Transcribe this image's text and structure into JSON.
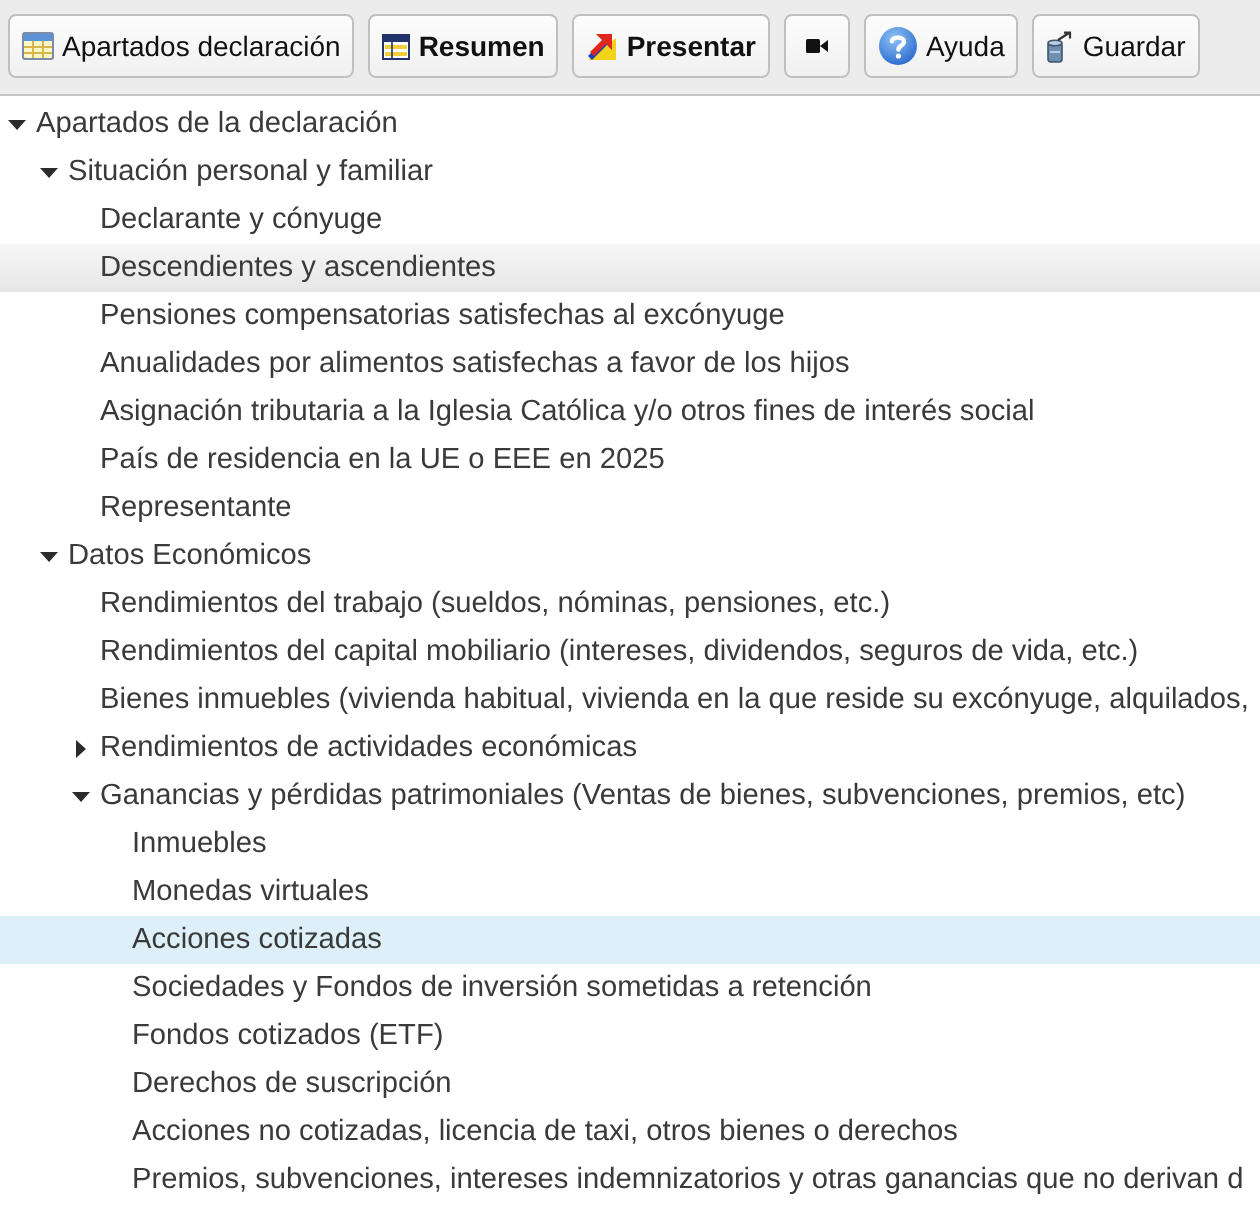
{
  "toolbar": {
    "buttons": [
      {
        "kind": "sections",
        "label": "Apartados declaración",
        "bold": false
      },
      {
        "kind": "summary",
        "label": "Resumen",
        "bold": true
      },
      {
        "kind": "submit",
        "label": "Presentar",
        "bold": true
      },
      {
        "kind": "video"
      },
      {
        "kind": "help",
        "label": "Ayuda",
        "bold": false
      },
      {
        "kind": "save",
        "label": "Guardar",
        "bold": false
      }
    ]
  },
  "tree": {
    "items": [
      {
        "label": "Apartados de la declaración",
        "expanded": true,
        "selected": false,
        "hovered": false,
        "children": [
          {
            "label": "Situación personal y familiar",
            "expanded": true,
            "selected": false,
            "hovered": false,
            "children": [
              {
                "label": "Declarante y cónyuge",
                "selected": false,
                "hovered": false
              },
              {
                "label": "Descendientes y ascendientes",
                "selected": false,
                "hovered": true
              },
              {
                "label": "Pensiones compensatorias satisfechas al excónyuge",
                "selected": false,
                "hovered": false
              },
              {
                "label": "Anualidades por alimentos satisfechas a favor de los hijos",
                "selected": false,
                "hovered": false
              },
              {
                "label": "Asignación tributaria a la Iglesia Católica y/o otros fines de interés social",
                "selected": false,
                "hovered": false
              },
              {
                "label": "País de residencia en la UE o EEE en 2025",
                "selected": false,
                "hovered": false
              },
              {
                "label": "Representante",
                "selected": false,
                "hovered": false
              }
            ]
          },
          {
            "label": "Datos Económicos",
            "expanded": true,
            "selected": false,
            "hovered": false,
            "children": [
              {
                "label": "Rendimientos del trabajo (sueldos, nóminas, pensiones, etc.)",
                "selected": false,
                "hovered": false
              },
              {
                "label": "Rendimientos del capital mobiliario (intereses, dividendos, seguros de vida, etc.)",
                "selected": false,
                "hovered": false
              },
              {
                "label": "Bienes inmuebles (vivienda habitual, vivienda en la que reside su excónyuge, alquilados,",
                "selected": false,
                "hovered": false
              },
              {
                "label": "Rendimientos de actividades económicas",
                "expanded": false,
                "selected": false,
                "hovered": false
              },
              {
                "label": "Ganancias y pérdidas patrimoniales (Ventas de bienes, subvenciones, premios, etc)",
                "expanded": true,
                "selected": false,
                "hovered": false,
                "children": [
                  {
                    "label": "Inmuebles",
                    "selected": false,
                    "hovered": false
                  },
                  {
                    "label": "Monedas virtuales",
                    "selected": false,
                    "hovered": false
                  },
                  {
                    "label": "Acciones cotizadas",
                    "selected": true,
                    "hovered": false
                  },
                  {
                    "label": "Sociedades y Fondos de inversión sometidas a retención",
                    "selected": false,
                    "hovered": false
                  },
                  {
                    "label": "Fondos cotizados (ETF)",
                    "selected": false,
                    "hovered": false
                  },
                  {
                    "label": "Derechos de suscripción",
                    "selected": false,
                    "hovered": false
                  },
                  {
                    "label": "Acciones no cotizadas, licencia de taxi, otros bienes o derechos",
                    "selected": false,
                    "hovered": false
                  },
                  {
                    "label": "Premios, subvenciones, intereses indemnizatorios y otras ganancias que no derivan d",
                    "selected": false,
                    "hovered": false
                  }
                ]
              }
            ]
          }
        ]
      }
    ]
  }
}
